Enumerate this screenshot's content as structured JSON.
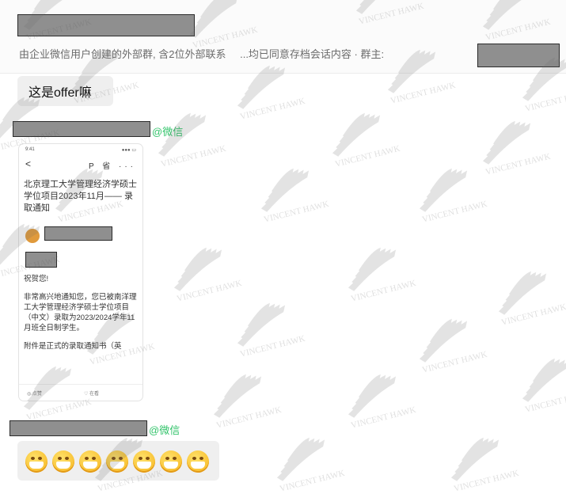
{
  "header": {
    "notice_part1": "由企业微信用户创建的外部群, 含2位外部联系",
    "notice_part2": "...均已同意存档会话内容 · 群主:"
  },
  "messages": [
    {
      "text": "这是offer嘛"
    },
    {
      "sender_tag": "@微信"
    },
    {
      "sender_tag": "@微信"
    }
  ],
  "card": {
    "status_left": "9:41",
    "status_right": "●●● ▭",
    "back": "<",
    "top_icons": "P 省 ···",
    "title": "北京理工大学管理经济学硕士学位项目2023年11月—— 录取通知",
    "greeting": "祝贺您!",
    "body": "非常高兴地通知您，您已被南洋理工大学管理经济学硕士学位项目（中文）录取为2023/2024学年11月班全日制学生。",
    "attachment_note": "附件是正式的录取通知书（英",
    "footer_left": "◎ 点赞",
    "footer_right": "♡ 在看"
  },
  "emoji_row": {
    "emoji_names": [
      "mask-face-icon",
      "mask-face-icon",
      "mask-face-icon",
      "mask-face-icon",
      "mask-face-icon",
      "mask-face-icon",
      "mask-face-icon"
    ]
  },
  "watermark": {
    "text": "VINCENT HAWK"
  },
  "colors": {
    "wechat_green": "#33c46b",
    "bubble": "#efefef",
    "redaction": "#8f8f8f"
  }
}
